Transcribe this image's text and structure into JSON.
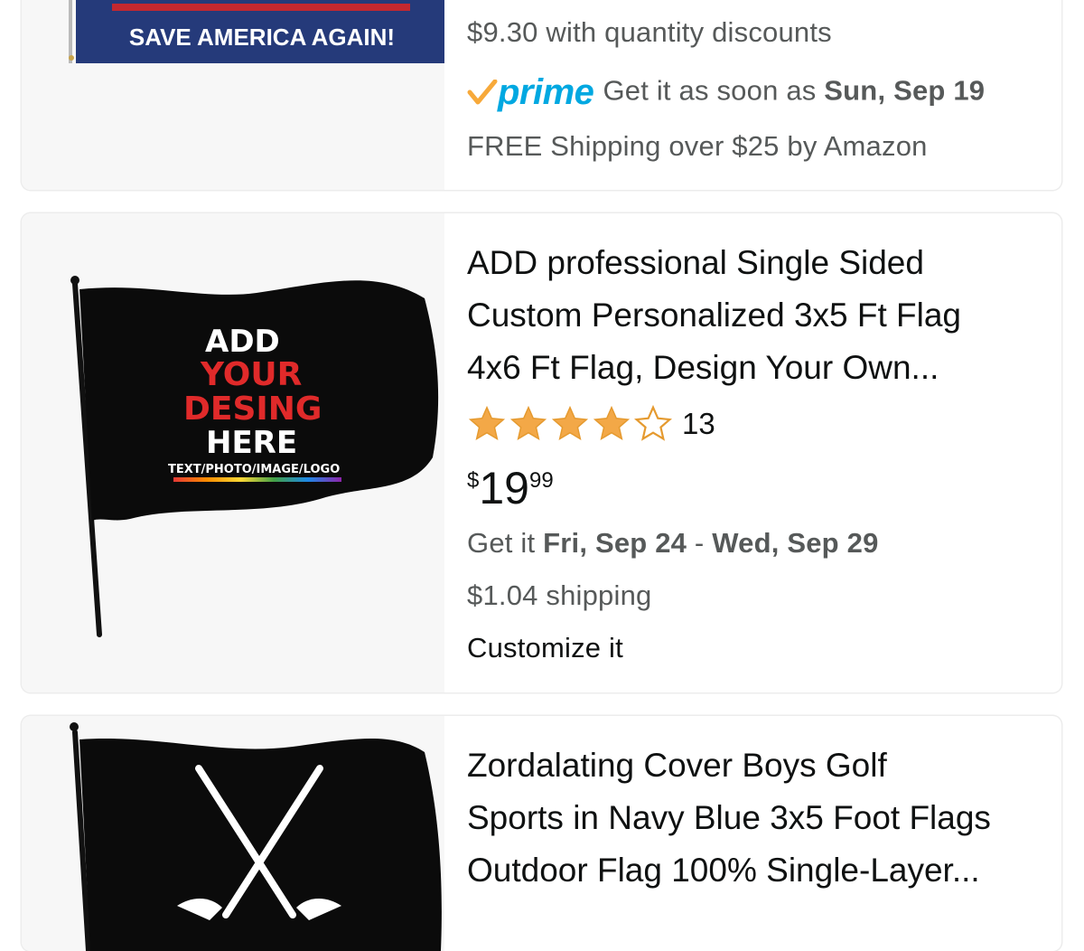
{
  "listings": [
    {
      "image": {
        "banner_text": "SAVE AMERICA AGAIN!",
        "colors": {
          "flag_blue": "#253a7a",
          "flag_red": "#c4282f"
        }
      },
      "quantity_discount": "$9.30 with quantity discounts",
      "prime": {
        "logo_text": "prime",
        "delivery_prefix": "Get it as soon as",
        "delivery_date": "Sun, Sep 19"
      },
      "shipping": "FREE Shipping over $25 by Amazon"
    },
    {
      "image": {
        "line1": "ADD",
        "line2": "YOUR",
        "line3": "DESING",
        "line4": "HERE",
        "line5": "TEXT/PHOTO/IMAGE/LOGO"
      },
      "title_lines": [
        "ADD professional Single Sided",
        "Custom Personalized 3x5 Ft Flag",
        "4x6 Ft Flag, Design Your Own..."
      ],
      "rating": {
        "stars": 4.0,
        "max": 5,
        "count": "13"
      },
      "price": {
        "currency": "$",
        "whole": "19",
        "fraction": "99"
      },
      "delivery": {
        "prefix": "Get it",
        "start": "Fri, Sep 24",
        "separator": " - ",
        "end": "Wed, Sep 29"
      },
      "shipping": "$1.04 shipping",
      "customize": "Customize it"
    },
    {
      "title_lines": [
        "Zordalating Cover Boys Golf",
        "Sports in Navy Blue 3x5 Foot Flags",
        "Outdoor Flag 100% Single-Layer..."
      ]
    }
  ],
  "colors": {
    "star": "#f3a847",
    "prime_blue": "#00a8e1",
    "prime_check": "#f7a93a",
    "muted_text": "#565959"
  }
}
